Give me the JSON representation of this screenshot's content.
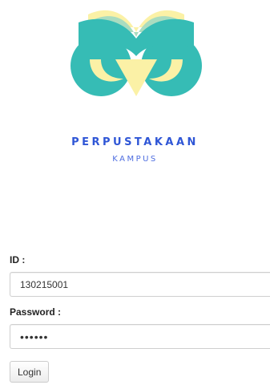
{
  "brand": {
    "logo_icon": "owl-book-icon",
    "title": "PERPUSTAKAAN",
    "subtitle": "KAMPUS",
    "colors": {
      "teal": "#36bcb5",
      "book_yellow": "#fbf1a6",
      "book_green": "#a9dcc0",
      "title_blue": "#2f56d6"
    }
  },
  "login_form": {
    "id_label": "ID :",
    "id_value": "130215001",
    "password_label": "Password :",
    "password_value": "secret",
    "login_label": "Login"
  }
}
